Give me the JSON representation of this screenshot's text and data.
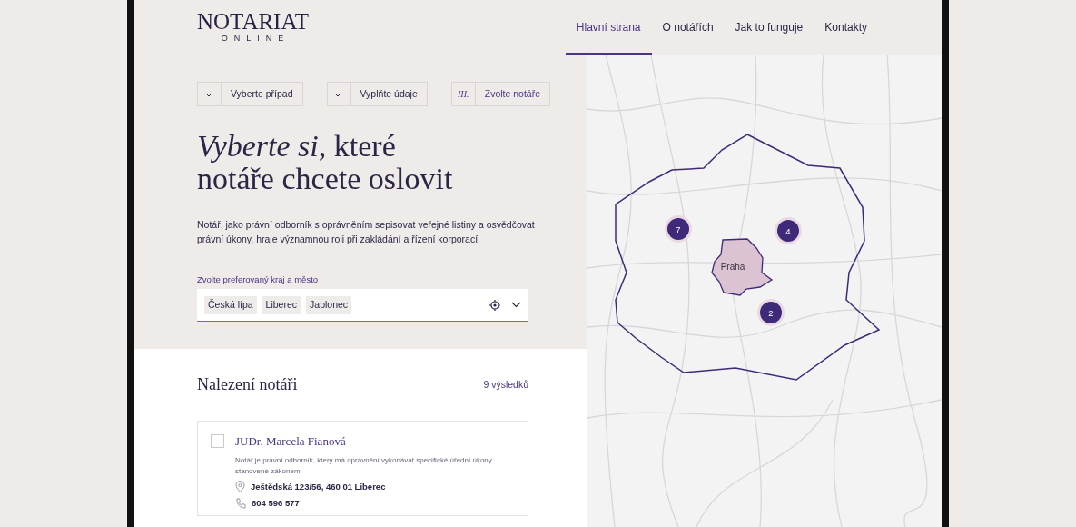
{
  "logo": {
    "title": "NOTARIAT",
    "subtitle": "ONLINE"
  },
  "nav": [
    {
      "label": "Hlavní strana",
      "selected": true
    },
    {
      "label": "O notářích",
      "selected": false
    },
    {
      "label": "Jak to funguje",
      "selected": false
    },
    {
      "label": "Kontakty",
      "selected": false
    }
  ],
  "steps": [
    {
      "label": "Vyberte případ",
      "done": true
    },
    {
      "label": "Vyplňte údaje",
      "done": true
    },
    {
      "label": "Zvolte notáře",
      "done": false,
      "numeral": "III."
    }
  ],
  "heading": [
    "*Vyberte si*, které",
    "notáře chcete oslovit"
  ],
  "intro": "Notář, jako právní odborník s oprávněním sepisovat veřejné listiny a osvědčovat právní úkony, hraje významnou roli při zakládání a řízení korporací.",
  "location_field": {
    "label": "Zvolte preferovaný kraj a město",
    "tags": [
      "Česká lípa",
      "Liberec",
      "Jablonec"
    ]
  },
  "results": {
    "title": "Nalezení notáři",
    "count": "9 výsledků",
    "notaries": [
      {
        "name": "JUDr. Marcela Fianová",
        "checked": false,
        "description": "Notář je právní odborník, který má oprávnění vykonávat specifické úřední úkony stanovené zákonem.",
        "address": "Ještědská 123/56, 460 01 Liberec",
        "phone": "604 596 577"
      }
    ]
  },
  "map": {
    "region_label": "Praha",
    "clusters": [
      {
        "count": "7"
      },
      {
        "count": "4"
      },
      {
        "count": "2"
      }
    ]
  }
}
